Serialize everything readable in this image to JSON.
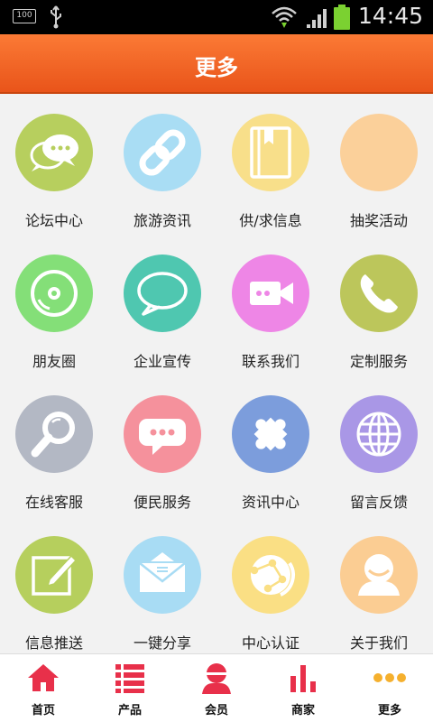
{
  "status_bar": {
    "battery_saver_label": "100",
    "time": "14:45"
  },
  "header": {
    "title": "更多"
  },
  "grid": {
    "items": [
      {
        "label": "论坛中心",
        "icon": "chat-bubbles-icon",
        "color": "#b7cf5e"
      },
      {
        "label": "旅游资讯",
        "icon": "link-chain-icon",
        "color": "#a9ddf4"
      },
      {
        "label": "供/求信息",
        "icon": "book-icon",
        "color": "#f8df8a"
      },
      {
        "label": "抽奖活动",
        "icon": "blank-icon",
        "color": "#fbd09a"
      },
      {
        "label": "朋友圈",
        "icon": "disc-icon",
        "color": "#84df78"
      },
      {
        "label": "企业宣传",
        "icon": "speech-bubble-icon",
        "color": "#4fc7b0"
      },
      {
        "label": "联系我们",
        "icon": "video-camera-icon",
        "color": "#ee86e6"
      },
      {
        "label": "定制服务",
        "icon": "phone-icon",
        "color": "#bcc65b"
      },
      {
        "label": "在线客服",
        "icon": "magnifier-icon",
        "color": "#b3b8c4"
      },
      {
        "label": "便民服务",
        "icon": "message-dots-icon",
        "color": "#f5919c"
      },
      {
        "label": "资讯中心",
        "icon": "puzzle-icon",
        "color": "#7c9ddc"
      },
      {
        "label": "留言反馈",
        "icon": "globe-icon",
        "color": "#a997e6"
      },
      {
        "label": "信息推送",
        "icon": "edit-note-icon",
        "color": "#b6cf5d"
      },
      {
        "label": "一键分享",
        "icon": "envelope-icon",
        "color": "#a8dcf4"
      },
      {
        "label": "中心认证",
        "icon": "certificate-globe-icon",
        "color": "#fadf84"
      },
      {
        "label": "关于我们",
        "icon": "user-icon",
        "color": "#fbcd93"
      }
    ]
  },
  "tabbar": {
    "accent_color": "#e8304a",
    "items": [
      {
        "label": "首页",
        "icon": "home-icon"
      },
      {
        "label": "产品",
        "icon": "list-icon"
      },
      {
        "label": "会员",
        "icon": "member-icon"
      },
      {
        "label": "商家",
        "icon": "bar-chart-icon"
      },
      {
        "label": "更多",
        "icon": "more-dots-icon"
      }
    ]
  }
}
